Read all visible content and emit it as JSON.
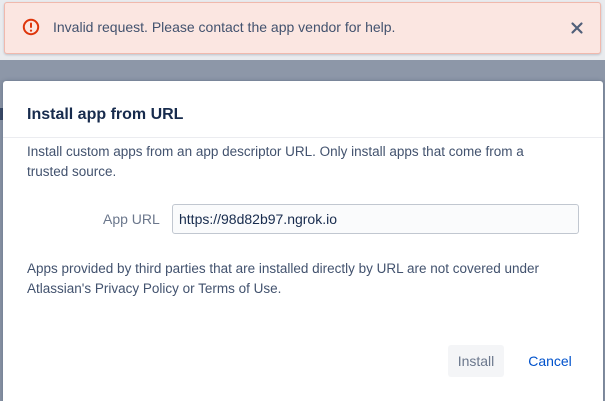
{
  "flag": {
    "message": "Invalid request. Please contact the app vendor for help.",
    "icon": "error-icon",
    "close_icon": "close-icon",
    "color": "#de350b"
  },
  "modal": {
    "title": "Install app from URL",
    "intro": "Install custom apps from an app descriptor URL. Only install apps that come from a trusted source.",
    "app_url_label": "App URL",
    "app_url_value": "https://98d82b97.ngrok.io",
    "disclaimer": "Apps provided by third parties that are installed directly by URL are not covered under Atlassian's Privacy Policy or Terms of Use.",
    "install_label": "Install",
    "cancel_label": "Cancel"
  }
}
